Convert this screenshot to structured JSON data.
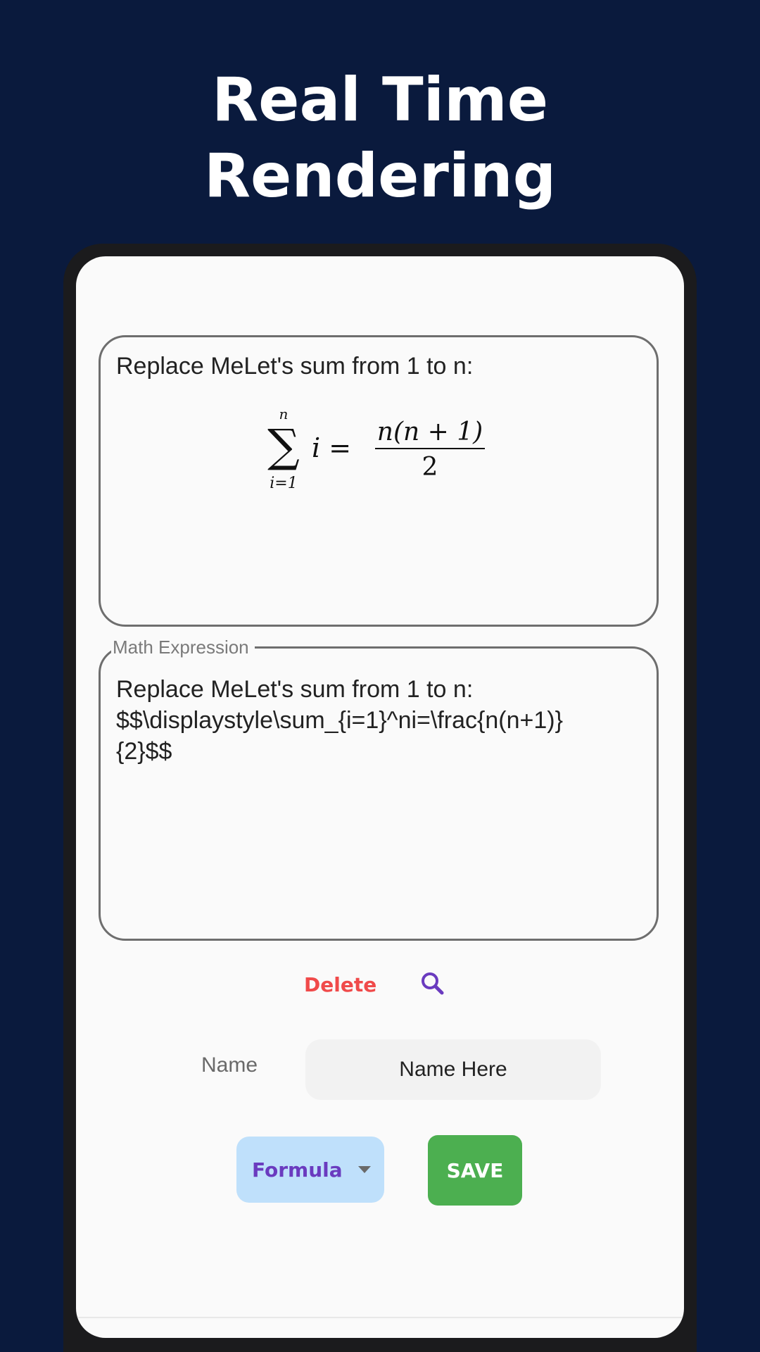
{
  "headline": {
    "line1": "Real Time",
    "line2": "Rendering"
  },
  "preview": {
    "text": "Replace MeLet's sum from 1 to n:",
    "formula": {
      "sum_upper": "n",
      "sum_lower": "i=1",
      "term": "i =",
      "numerator": "n(n + 1)",
      "denominator": "2"
    }
  },
  "expression": {
    "label": "Math Expression",
    "value": "Replace MeLet's sum from 1 to n:\n$$\\displaystyle\\sum_{i=1}^ni=\\frac{n(n+1)}\n{2}$$"
  },
  "actions": {
    "delete_label": "Delete",
    "search_icon": "search-icon"
  },
  "name_row": {
    "label": "Name",
    "value": "Name Here"
  },
  "type_dropdown": {
    "selected": "Formula"
  },
  "save_label": "SAVE",
  "colors": {
    "background": "#0a1a3d",
    "delete": "#f04a4a",
    "accent_purple": "#6a3bbf",
    "dropdown_bg": "#bfe0fb",
    "save_bg": "#4caf50"
  }
}
